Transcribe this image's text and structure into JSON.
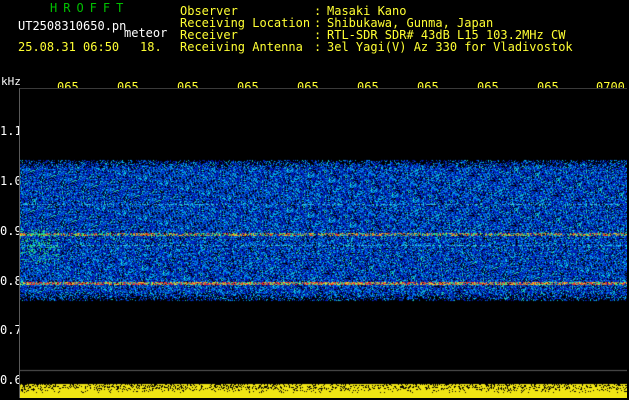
{
  "brand": {
    "text": "HROFFT"
  },
  "file": {
    "name": "UT2508310650.pn",
    "overlay": "meteor",
    "datetime": "25.08.31 06:50",
    "seconds": "18."
  },
  "station": {
    "labels": [
      "Observer",
      "Receiving Location",
      "Receiver",
      "Receiving Antenna"
    ],
    "colons": [
      ":",
      ":",
      ":",
      ":"
    ],
    "values": [
      "Masaki Kano",
      "Shibukawa, Gunma, Japan",
      "RTL-SDR SDR# 43dB L15 103.2MHz CW",
      "3el Yagi(V) Az 330 for Vladivostok"
    ]
  },
  "axes": {
    "y_unit": "kHz",
    "y_ticks": [
      "1.1",
      "1.0",
      "0.9",
      "0.8",
      "0.7",
      "0.6"
    ],
    "x_ticks": [
      "065",
      "065",
      "065",
      "065",
      "065",
      "065",
      "065",
      "065",
      "065",
      "0700"
    ]
  },
  "colors": {
    "brand": "#00c000",
    "text": "#ffffff",
    "labels": "#ffff33",
    "tick": "#ffffff"
  }
}
